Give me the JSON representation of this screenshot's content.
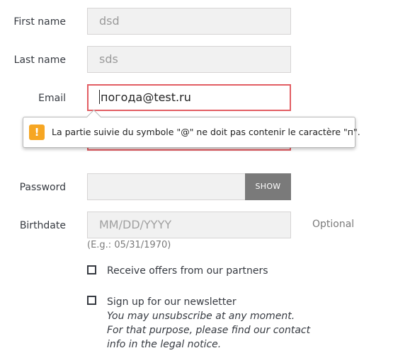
{
  "first_name": {
    "label": "First name",
    "value": "dsd"
  },
  "last_name": {
    "label": "Last name",
    "value": "sds"
  },
  "email": {
    "label": "Email",
    "value": "погода@test.ru"
  },
  "validation": {
    "message": "La partie suivie du symbole \"@\" ne doit pas contenir le caractère \"п\".",
    "icon": "warning-icon"
  },
  "password": {
    "label": "Password",
    "value": "",
    "show_label": "SHOW"
  },
  "birthdate": {
    "label": "Birthdate",
    "placeholder": "MM/DD/YYYY",
    "optional": "Optional",
    "hint": "(E.g.: 05/31/1970)"
  },
  "partners": {
    "label": "Receive offers from our partners"
  },
  "newsletter": {
    "label": "Sign up for our newsletter",
    "note_line1": "You may unsubscribe at any moment.",
    "note_line2": "For that purpose, please find our contact",
    "note_line3": "info in the legal notice."
  }
}
